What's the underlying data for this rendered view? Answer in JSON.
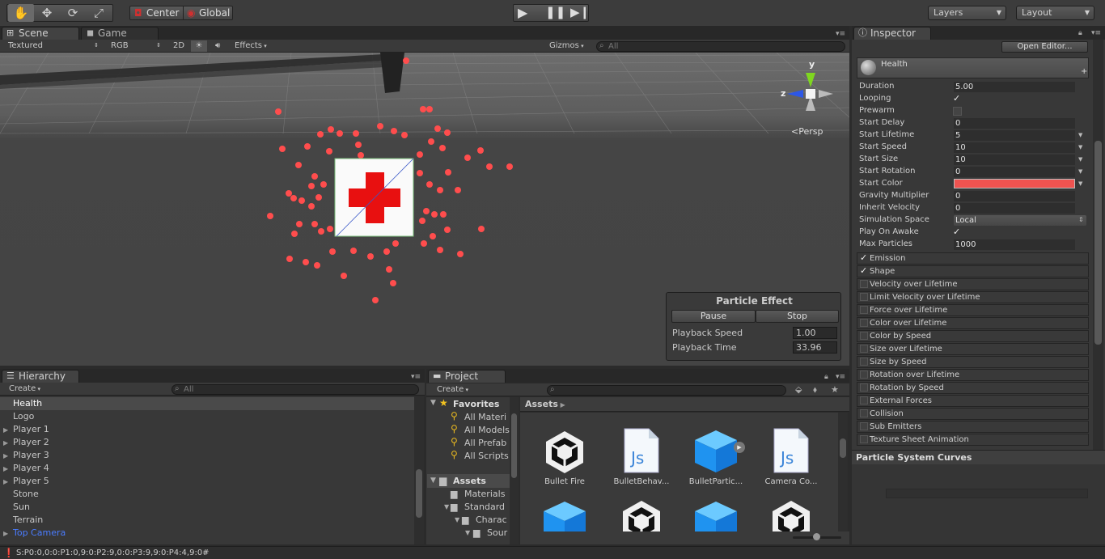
{
  "toolbar": {
    "tools": [
      "hand-tool",
      "move-tool",
      "rotate-tool",
      "scale-tool"
    ],
    "pivot": "Center",
    "space": "Global",
    "layers": "Layers",
    "layout": "Layout"
  },
  "scene": {
    "tabs": [
      "Scene",
      "Game"
    ],
    "shading": "Textured",
    "render_mode": "RGB",
    "mode_2d": "2D",
    "effects": "Effects",
    "gizmos": "Gizmos",
    "search_placeholder": "All",
    "persp": "Persp",
    "axis_y": "y",
    "axis_z": "z"
  },
  "particle_effect": {
    "title": "Particle Effect",
    "pause": "Pause",
    "stop": "Stop",
    "playback_speed_label": "Playback Speed",
    "playback_speed": "1.00",
    "playback_time_label": "Playback Time",
    "playback_time": "33.96"
  },
  "hierarchy": {
    "tab": "Hierarchy",
    "create": "Create",
    "search_placeholder": "All",
    "items": [
      {
        "label": "Health",
        "arrow": false
      },
      {
        "label": "Logo",
        "arrow": false
      },
      {
        "label": "Player 1",
        "arrow": true
      },
      {
        "label": "Player 2",
        "arrow": true
      },
      {
        "label": "Player 3",
        "arrow": true
      },
      {
        "label": "Player 4",
        "arrow": true
      },
      {
        "label": "Player 5",
        "arrow": true
      },
      {
        "label": "Stone",
        "arrow": false
      },
      {
        "label": "Sun",
        "arrow": false
      },
      {
        "label": "Terrain",
        "arrow": false
      },
      {
        "label": "Top Camera",
        "arrow": true
      }
    ]
  },
  "project": {
    "tab": "Project",
    "create": "Create",
    "favorites": "Favorites",
    "favorite_items": [
      "All Materi",
      "All Models",
      "All Prefab",
      "All Scripts"
    ],
    "assets_label": "Assets",
    "folders": [
      "Materials",
      "Standard",
      "Charac",
      "Sour"
    ],
    "breadcrumb": "Assets",
    "assets": [
      {
        "label": "Bullet Fire",
        "kind": "unity"
      },
      {
        "label": "BulletBehav...",
        "kind": "js"
      },
      {
        "label": "BulletPartic...",
        "kind": "cube"
      },
      {
        "label": "Camera Co...",
        "kind": "js"
      }
    ],
    "assets_row2": [
      "cube",
      "unity",
      "cube",
      "unity"
    ]
  },
  "inspector": {
    "tab": "Inspector",
    "open_editor": "Open Editor...",
    "component": "Health",
    "props": [
      {
        "label": "Duration",
        "value": "5.00"
      },
      {
        "label": "Looping",
        "value": "✓"
      },
      {
        "label": "Prewarm",
        "value": ""
      },
      {
        "label": "Start Delay",
        "value": "0"
      },
      {
        "label": "Start Lifetime",
        "value": "5"
      },
      {
        "label": "Start Speed",
        "value": "10"
      },
      {
        "label": "Start Size",
        "value": "10"
      },
      {
        "label": "Start Rotation",
        "value": "0"
      },
      {
        "label": "Start Color",
        "value": ""
      },
      {
        "label": "Gravity Multiplier",
        "value": "0"
      },
      {
        "label": "Inherit Velocity",
        "value": "0"
      },
      {
        "label": "Simulation Space",
        "value": "Local"
      },
      {
        "label": "Play On Awake",
        "value": "✓"
      },
      {
        "label": "Max Particles",
        "value": "1000"
      }
    ],
    "start_color": "#ef5350",
    "modules": [
      {
        "label": "Emission",
        "checked": true
      },
      {
        "label": "Shape",
        "checked": true
      },
      {
        "label": "Velocity over Lifetime",
        "checked": false
      },
      {
        "label": "Limit Velocity over Lifetime",
        "checked": false
      },
      {
        "label": "Force over Lifetime",
        "checked": false
      },
      {
        "label": "Color over Lifetime",
        "checked": false
      },
      {
        "label": "Color by Speed",
        "checked": false
      },
      {
        "label": "Size over Lifetime",
        "checked": false
      },
      {
        "label": "Size by Speed",
        "checked": false
      },
      {
        "label": "Rotation over Lifetime",
        "checked": false
      },
      {
        "label": "Rotation by Speed",
        "checked": false
      },
      {
        "label": "External Forces",
        "checked": false
      },
      {
        "label": "Collision",
        "checked": false
      },
      {
        "label": "Sub Emitters",
        "checked": false
      },
      {
        "label": "Texture Sheet Animation",
        "checked": false
      }
    ],
    "curves": "Particle System Curves"
  },
  "status": {
    "text": "S:P0:0,0:0:P1:0,9:0:P2:9,0:0:P3:9,9:0:P4:4,9:0#"
  }
}
